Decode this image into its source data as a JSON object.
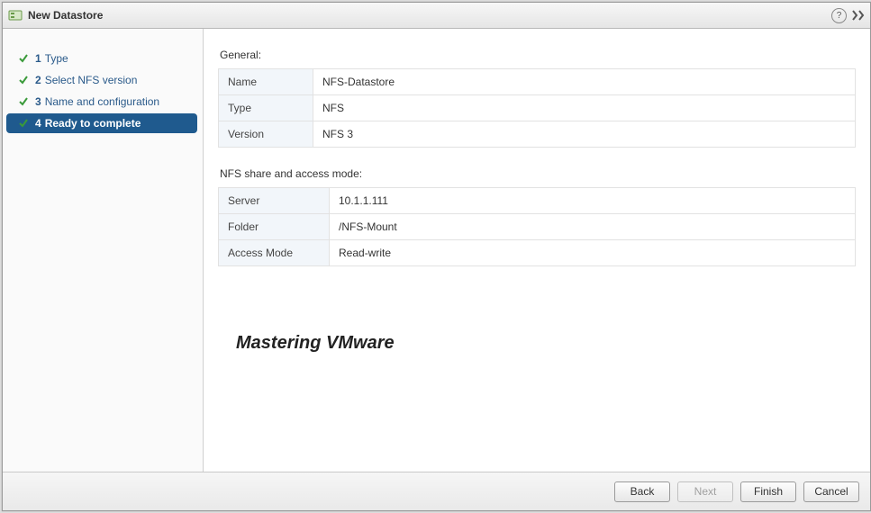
{
  "title": "New Datastore",
  "sidebar": {
    "steps": [
      {
        "num": "1",
        "label": "Type"
      },
      {
        "num": "2",
        "label": "Select NFS version"
      },
      {
        "num": "3",
        "label": "Name and configuration"
      },
      {
        "num": "4",
        "label": "Ready to complete"
      }
    ]
  },
  "sections": {
    "general": {
      "heading": "General:",
      "rows": [
        {
          "key": "Name",
          "value": "NFS-Datastore"
        },
        {
          "key": "Type",
          "value": "NFS"
        },
        {
          "key": "Version",
          "value": "NFS 3"
        }
      ]
    },
    "nfs": {
      "heading": "NFS share and access mode:",
      "rows": [
        {
          "key": "Server",
          "value": "10.1.1.111"
        },
        {
          "key": "Folder",
          "value": "/NFS-Mount"
        },
        {
          "key": "Access Mode",
          "value": "Read-write"
        }
      ]
    }
  },
  "watermark": "Mastering VMware",
  "footer": {
    "back": "Back",
    "next": "Next",
    "finish": "Finish",
    "cancel": "Cancel"
  }
}
